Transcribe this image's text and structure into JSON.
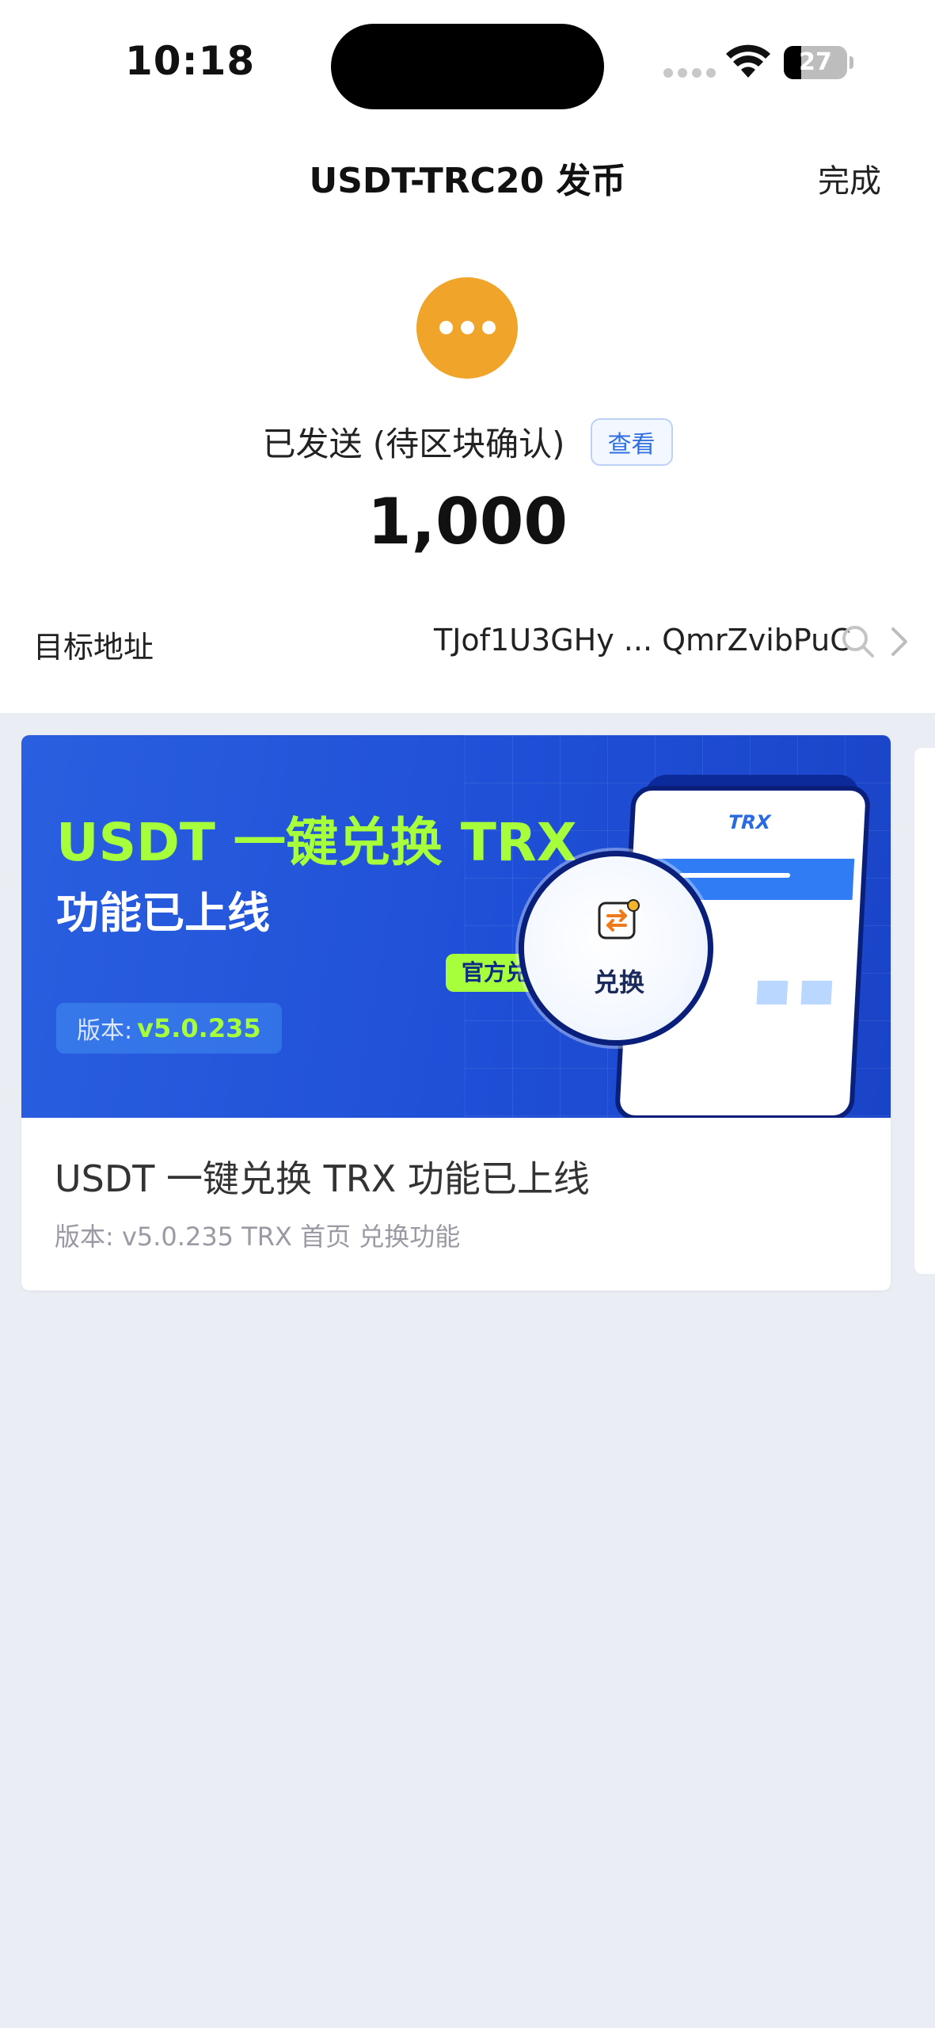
{
  "status_bar": {
    "time": "10:18",
    "battery_level": "27",
    "battery_fraction": 0.27
  },
  "nav": {
    "title": "USDT-TRC20 发币",
    "done_label": "完成"
  },
  "transaction": {
    "status_text": "已发送 (待区块确认)",
    "view_label": "查看",
    "amount": "1,000",
    "target_label": "目标地址",
    "target_address": "TJof1U3GHy ... QmrZvibPuC",
    "status_color": "#f0a52a"
  },
  "banner": {
    "headline": "USDT 一键兑换 TRX",
    "subheadline": "功能已上线",
    "version_prefix": "版本:",
    "version": "v5.0.235",
    "phone_token": "TRX",
    "lens_label": "兑换",
    "official_tag": "官方兑换",
    "accent_color": "#a6ff3a",
    "bg_color": "#2a5fe0"
  },
  "card": {
    "title": "USDT 一键兑换 TRX 功能已上线",
    "meta": "版本:  v5.0.235 TRX  首页 兑换功能"
  },
  "icons": {
    "status": "more-dots-icon",
    "search": "search-icon",
    "chevron": "chevron-right-icon",
    "wifi": "wifi-icon",
    "battery": "battery-icon",
    "swap": "swap-icon"
  }
}
